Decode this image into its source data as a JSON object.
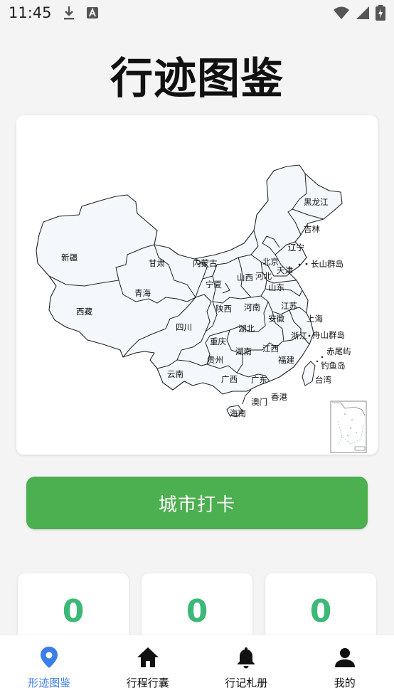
{
  "status_bar": {
    "time": "11:45"
  },
  "page": {
    "title": "行迹图鉴"
  },
  "map": {
    "provinces": [
      {
        "name": "新疆"
      },
      {
        "name": "西藏"
      },
      {
        "name": "青海"
      },
      {
        "name": "甘肃"
      },
      {
        "name": "内蒙古"
      },
      {
        "name": "黑龙江"
      },
      {
        "name": "吉林"
      },
      {
        "name": "辽宁"
      },
      {
        "name": "北京"
      },
      {
        "name": "天津"
      },
      {
        "name": "河北"
      },
      {
        "name": "山西"
      },
      {
        "name": "宁夏"
      },
      {
        "name": "山东"
      },
      {
        "name": "陕西"
      },
      {
        "name": "河南"
      },
      {
        "name": "江苏"
      },
      {
        "name": "四川"
      },
      {
        "name": "湖北"
      },
      {
        "name": "安徽"
      },
      {
        "name": "上海"
      },
      {
        "name": "重庆"
      },
      {
        "name": "浙江"
      },
      {
        "name": "湖南"
      },
      {
        "name": "江西"
      },
      {
        "name": "贵州"
      },
      {
        "name": "福建"
      },
      {
        "name": "云南"
      },
      {
        "name": "广西"
      },
      {
        "name": "广东"
      },
      {
        "name": "台湾"
      },
      {
        "name": "香港"
      },
      {
        "name": "澳门"
      },
      {
        "name": "海南"
      }
    ],
    "islands": [
      {
        "name": "长山群岛"
      },
      {
        "name": "舟山群岛"
      },
      {
        "name": "赤尾屿"
      },
      {
        "name": "钓鱼岛"
      }
    ]
  },
  "checkin": {
    "label": "城市打卡"
  },
  "stats": [
    {
      "value": "0"
    },
    {
      "value": "0"
    },
    {
      "value": "0"
    }
  ],
  "nav": {
    "items": [
      {
        "label": "形迹图鉴",
        "icon": "location-pin-icon"
      },
      {
        "label": "行程行囊",
        "icon": "home-icon"
      },
      {
        "label": "行记札册",
        "icon": "bell-icon"
      },
      {
        "label": "我的",
        "icon": "person-icon"
      }
    ],
    "active_color": "#3b7ee8"
  },
  "colors": {
    "accent": "#4caf50",
    "stat_value": "#3cb878",
    "map_fill": "#f4f8fc"
  }
}
